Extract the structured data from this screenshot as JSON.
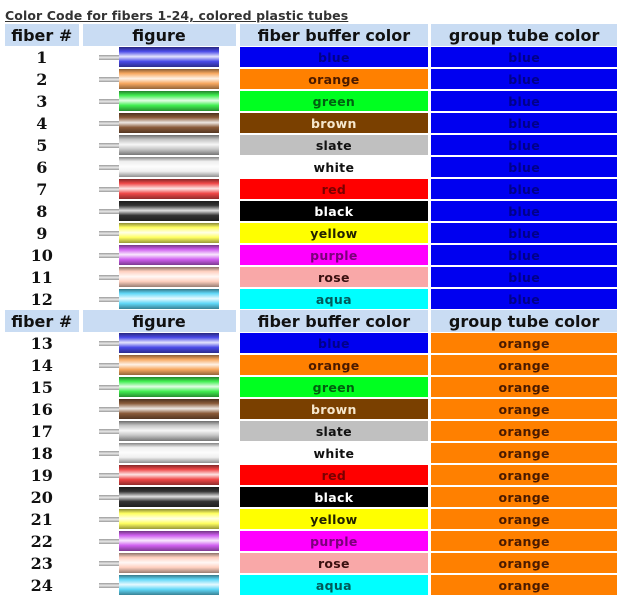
{
  "title": "Color Code for fibers 1-24, colored plastic tubes",
  "headers": {
    "fiber": "fiber #",
    "figure": "figure",
    "buffer": "fiber buffer color",
    "group": "group tube color"
  },
  "colors": {
    "blue": {
      "bg": "#0000f0",
      "fg": "#00008a",
      "tube": "#4a4ae8"
    },
    "orange": {
      "bg": "#ff8000",
      "fg": "#4a1a00",
      "tube": "#f7a860"
    },
    "green": {
      "bg": "#00ff20",
      "fg": "#006010",
      "tube": "#40ee50"
    },
    "brown": {
      "bg": "#7a4000",
      "fg": "#f5e6cc",
      "tube": "#8a5a38"
    },
    "slate": {
      "bg": "#c0c0c0",
      "fg": "#111111",
      "tube": "#c4c4c4"
    },
    "white": {
      "bg": "#ffffff",
      "fg": "#111111",
      "tube": "#efefef"
    },
    "red": {
      "bg": "#ff0000",
      "fg": "#7a0000",
      "tube": "#f04848"
    },
    "black": {
      "bg": "#000000",
      "fg": "#ffffff",
      "tube": "#333333"
    },
    "yellow": {
      "bg": "#ffff00",
      "fg": "#222200",
      "tube": "#ffff60"
    },
    "purple": {
      "bg": "#ff00ff",
      "fg": "#7a007a",
      "tube": "#d060f0"
    },
    "rose": {
      "bg": "#f9a8a8",
      "fg": "#3a1010",
      "tube": "#ffd0c0"
    },
    "aqua": {
      "bg": "#00ffff",
      "fg": "#005a5a",
      "tube": "#60d8f8"
    }
  },
  "groups": [
    {
      "group_color": "blue",
      "rows": [
        {
          "fiber": "1",
          "buffer": "blue",
          "group": "blue"
        },
        {
          "fiber": "2",
          "buffer": "orange",
          "group": "blue"
        },
        {
          "fiber": "3",
          "buffer": "green",
          "group": "blue"
        },
        {
          "fiber": "4",
          "buffer": "brown",
          "group": "blue"
        },
        {
          "fiber": "5",
          "buffer": "slate",
          "group": "blue"
        },
        {
          "fiber": "6",
          "buffer": "white",
          "group": "blue"
        },
        {
          "fiber": "7",
          "buffer": "red",
          "group": "blue"
        },
        {
          "fiber": "8",
          "buffer": "black",
          "group": "blue"
        },
        {
          "fiber": "9",
          "buffer": "yellow",
          "group": "blue"
        },
        {
          "fiber": "10",
          "buffer": "purple",
          "group": "blue"
        },
        {
          "fiber": "11",
          "buffer": "rose",
          "group": "blue"
        },
        {
          "fiber": "12",
          "buffer": "aqua",
          "group": "blue"
        }
      ]
    },
    {
      "group_color": "orange",
      "rows": [
        {
          "fiber": "13",
          "buffer": "blue",
          "group": "orange"
        },
        {
          "fiber": "14",
          "buffer": "orange",
          "group": "orange"
        },
        {
          "fiber": "15",
          "buffer": "green",
          "group": "orange"
        },
        {
          "fiber": "16",
          "buffer": "brown",
          "group": "orange"
        },
        {
          "fiber": "17",
          "buffer": "slate",
          "group": "orange"
        },
        {
          "fiber": "18",
          "buffer": "white",
          "group": "orange"
        },
        {
          "fiber": "19",
          "buffer": "red",
          "group": "orange"
        },
        {
          "fiber": "20",
          "buffer": "black",
          "group": "orange"
        },
        {
          "fiber": "21",
          "buffer": "yellow",
          "group": "orange"
        },
        {
          "fiber": "22",
          "buffer": "purple",
          "group": "orange"
        },
        {
          "fiber": "23",
          "buffer": "rose",
          "group": "orange"
        },
        {
          "fiber": "24",
          "buffer": "aqua",
          "group": "orange"
        }
      ]
    }
  ]
}
